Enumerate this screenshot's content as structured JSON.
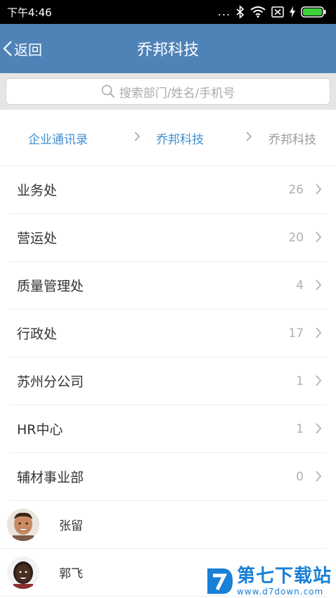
{
  "status_bar": {
    "time": "下午4:46",
    "more": "..."
  },
  "nav": {
    "back_label": "返回",
    "title": "乔邦科技"
  },
  "search": {
    "placeholder": "搜索部门/姓名/手机号"
  },
  "breadcrumb": [
    "企业通讯录",
    "乔邦科技",
    "乔邦科技"
  ],
  "departments": [
    {
      "name": "业务处",
      "count": "26"
    },
    {
      "name": "营运处",
      "count": "20"
    },
    {
      "name": "质量管理处",
      "count": "4"
    },
    {
      "name": "行政处",
      "count": "17"
    },
    {
      "name": "苏州分公司",
      "count": "1"
    },
    {
      "name": "HR中心",
      "count": "1"
    },
    {
      "name": "辅材事业部",
      "count": "0"
    }
  ],
  "people": [
    {
      "name": "张留",
      "avatar_icon": "avatar-man-icon"
    },
    {
      "name": "郭飞",
      "avatar_icon": "avatar-woman-icon"
    }
  ],
  "watermark": {
    "title": "第七下载站",
    "url": "www.d7down.com"
  },
  "colors": {
    "nav_bg": "#4f83b8",
    "link_blue": "#3f8fd4",
    "search_bg": "#e6e6e6",
    "battery_green": "#3bd13b",
    "watermark_blue": "#1a7fd6"
  }
}
